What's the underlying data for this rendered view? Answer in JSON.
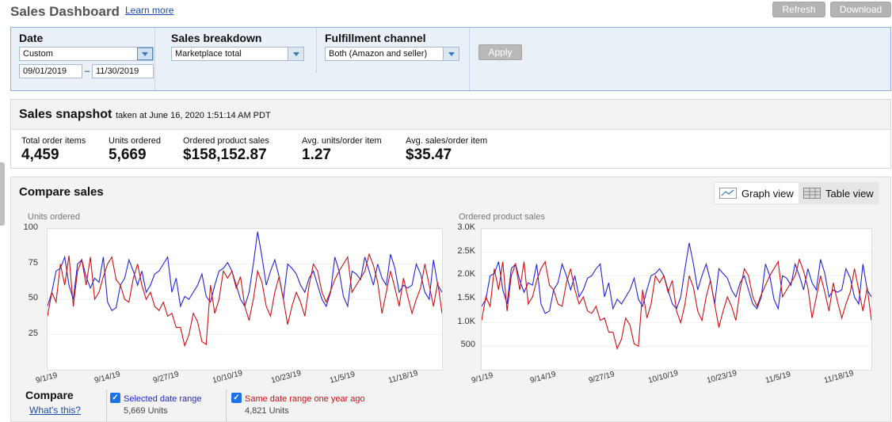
{
  "header": {
    "title": "Sales Dashboard",
    "learn_more": "Learn more",
    "refresh": "Refresh",
    "download": "Download"
  },
  "filters": {
    "date": {
      "label": "Date",
      "value": "Custom",
      "start": "09/01/2019",
      "sep": "–",
      "end": "11/30/2019"
    },
    "breakdown": {
      "label": "Sales breakdown",
      "value": "Marketplace total"
    },
    "channel": {
      "label": "Fulfillment channel",
      "value": "Both (Amazon and seller)"
    },
    "apply": "Apply"
  },
  "snapshot": {
    "title": "Sales snapshot",
    "taken": "taken at June 16, 2020 1:51:14 AM PDT",
    "metrics": [
      {
        "label": "Total order items",
        "value": "4,459"
      },
      {
        "label": "Units ordered",
        "value": "5,669"
      },
      {
        "label": "Ordered product sales",
        "value": "$158,152.87"
      },
      {
        "label": "Avg. units/order item",
        "value": "1.27"
      },
      {
        "label": "Avg. sales/order item",
        "value": "$35.47"
      }
    ]
  },
  "compare": {
    "title": "Compare sales",
    "graph_view": "Graph view",
    "table_view": "Table view",
    "legend_title": "Compare",
    "whats_this": "What's this?",
    "selected_label": "Selected date range",
    "selected_value": "5,669 Units",
    "last_year_label": "Same date range one year ago",
    "last_year_value": "4,821 Units"
  },
  "colors": {
    "selected": "#2424d6",
    "last_year": "#cc1111",
    "accent": "#1a4bb0"
  },
  "chart_data": [
    {
      "type": "line",
      "ylabel": "Units ordered",
      "ylim": [
        0,
        100
      ],
      "yticks": [
        "100",
        "75",
        "50",
        "25"
      ],
      "categories": [
        "9/1/19",
        "9/14/19",
        "9/27/19",
        "10/10/19",
        "10/23/19",
        "11/5/19",
        "11/18/19"
      ],
      "series": [
        {
          "name": "Selected date range",
          "values": [
            45,
            55,
            70,
            72,
            80,
            60,
            50,
            75,
            78,
            66,
            58,
            65,
            62,
            80,
            48,
            42,
            44,
            60,
            65,
            78,
            70,
            60,
            70,
            55,
            60,
            68,
            70,
            75,
            80,
            55,
            65,
            45,
            52,
            50,
            55,
            60,
            68,
            52,
            48,
            60,
            70,
            72,
            76,
            70,
            60,
            50,
            45,
            55,
            75,
            98,
            80,
            60,
            70,
            78,
            66,
            50,
            75,
            72,
            68,
            60,
            55,
            65,
            70,
            60,
            50,
            45,
            55,
            80,
            70,
            52,
            45,
            70,
            68,
            64,
            80,
            70,
            60,
            75,
            65,
            60,
            82,
            72,
            55,
            60,
            58,
            60,
            75,
            68,
            55,
            50,
            78,
            60,
            55
          ]
        },
        {
          "name": "Same date range one year ago",
          "values": [
            38,
            55,
            48,
            75,
            60,
            81,
            45,
            70,
            78,
            60,
            80,
            50,
            55,
            66,
            75,
            80,
            64,
            60,
            50,
            48,
            65,
            75,
            60,
            50,
            55,
            45,
            42,
            48,
            38,
            40,
            30,
            30,
            17,
            25,
            40,
            34,
            20,
            18,
            60,
            40,
            50,
            70,
            65,
            70,
            58,
            66,
            45,
            35,
            50,
            70,
            62,
            45,
            38,
            55,
            66,
            50,
            32,
            45,
            55,
            48,
            38,
            60,
            75,
            70,
            55,
            48,
            56,
            64,
            70,
            75,
            80,
            55,
            60,
            65,
            70,
            82,
            74,
            62,
            40,
            55,
            70,
            58,
            45,
            65,
            52,
            40,
            50,
            58,
            75,
            60,
            45,
            62,
            40
          ]
        }
      ]
    },
    {
      "type": "line",
      "ylabel": "Ordered product sales",
      "ylim": [
        0,
        3000
      ],
      "yticks": [
        "3.0K",
        "2.5K",
        "2.0K",
        "1.5K",
        "1.0K",
        "500"
      ],
      "categories": [
        "9/1/19",
        "9/14/19",
        "9/27/19",
        "10/10/19",
        "10/23/19",
        "11/5/19",
        "11/18/19"
      ],
      "series": [
        {
          "name": "Selected date range",
          "values": [
            1350,
            1500,
            2000,
            2050,
            2300,
            1700,
            1400,
            2150,
            2250,
            1900,
            1650,
            1850,
            1800,
            2250,
            1400,
            1200,
            1250,
            1700,
            1850,
            2250,
            2000,
            1700,
            2000,
            1550,
            1700,
            1950,
            2000,
            2150,
            2250,
            1550,
            1850,
            1300,
            1500,
            1400,
            1550,
            1700,
            1950,
            1500,
            1350,
            1700,
            2000,
            2050,
            2150,
            2000,
            1700,
            1400,
            1300,
            1550,
            2150,
            2700,
            2250,
            1700,
            2000,
            2250,
            1900,
            1400,
            2150,
            2050,
            1950,
            1700,
            1550,
            1850,
            2000,
            1700,
            1400,
            1300,
            1550,
            2250,
            2000,
            1500,
            1300,
            2000,
            1950,
            1800,
            2250,
            2000,
            1700,
            2150,
            1850,
            1700,
            2350,
            2050,
            1550,
            1700,
            1650,
            1700,
            2150,
            1950,
            1550,
            1400,
            2250,
            1700,
            1550
          ]
        },
        {
          "name": "Same date range one year ago",
          "values": [
            1050,
            1550,
            1350,
            2150,
            1700,
            2300,
            1250,
            2000,
            2250,
            1700,
            2300,
            1400,
            1550,
            1900,
            2150,
            2300,
            1800,
            1700,
            1400,
            1350,
            1850,
            2150,
            1700,
            1400,
            1550,
            1250,
            1200,
            1350,
            1050,
            1100,
            800,
            800,
            450,
            650,
            1100,
            950,
            550,
            500,
            1700,
            1100,
            1400,
            2000,
            1850,
            2000,
            1650,
            1900,
            1250,
            1000,
            1400,
            2000,
            1750,
            1250,
            1050,
            1550,
            1900,
            1400,
            900,
            1250,
            1550,
            1350,
            1050,
            1700,
            2150,
            2000,
            1550,
            1350,
            1600,
            1800,
            2000,
            2150,
            2300,
            1550,
            1700,
            1850,
            2000,
            2350,
            2100,
            1750,
            1100,
            1550,
            2000,
            1650,
            1250,
            1850,
            1450,
            1100,
            1400,
            1650,
            2150,
            1700,
            1250,
            1750,
            1050
          ]
        }
      ]
    }
  ]
}
